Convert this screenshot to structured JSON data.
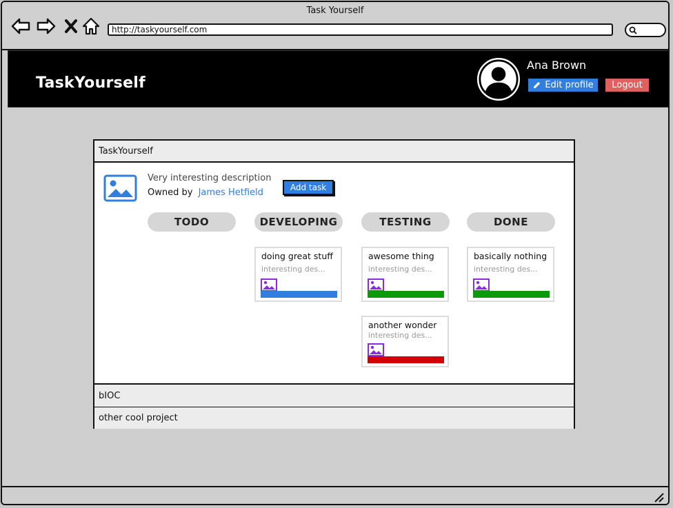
{
  "browser": {
    "title": "Task Yourself",
    "url": "http://taskyourself.com"
  },
  "header": {
    "brand": "TaskYourself",
    "user_name": "Ana Brown",
    "edit_profile_label": "Edit profile",
    "logout_label": "Logout"
  },
  "projects": [
    {
      "name": "TaskYourself",
      "expanded": true,
      "description": "Very interesting description",
      "owned_by_label": "Owned by",
      "owner": "James Hetfield",
      "add_task_label": "Add task",
      "columns": [
        {
          "label": "TODO",
          "cards": []
        },
        {
          "label": "DEVELOPING",
          "cards": [
            {
              "title": "doing great stuff",
              "desc": "interesting des...",
              "color": "#2f7ee0"
            }
          ]
        },
        {
          "label": "TESTING",
          "cards": [
            {
              "title": "awesome thing",
              "desc": "interesting des...",
              "color": "#0a9a0a"
            },
            {
              "title": "another wonder",
              "desc": "interesting des...",
              "color": "#d40000"
            }
          ]
        },
        {
          "label": "DONE",
          "cards": [
            {
              "title": "basically nothing",
              "desc": "interesting des...",
              "color": "#0a9a0a"
            }
          ]
        }
      ]
    },
    {
      "name": "bIOC",
      "expanded": false
    },
    {
      "name": "other cool project",
      "expanded": false
    }
  ],
  "colors": {
    "accent": "#2f7ee0",
    "logout": "#e06060",
    "image_icon": "#8a2be2",
    "header_bg": "#000000"
  }
}
